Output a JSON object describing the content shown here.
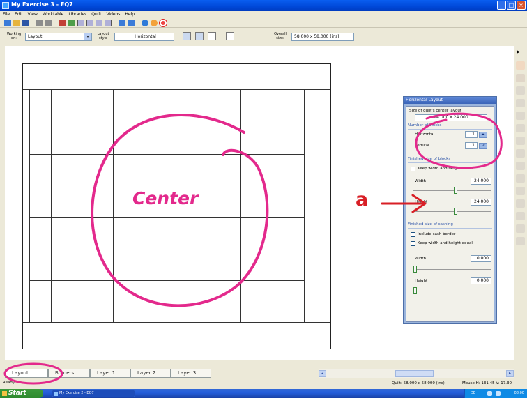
{
  "window": {
    "title": "My Exercise 3 - EQ7",
    "buttons": {
      "minimize": "_",
      "maximize": "□",
      "close": "×"
    }
  },
  "menu": [
    "File",
    "Edit",
    "View",
    "Worktable",
    "Libraries",
    "Quilt",
    "Videos",
    "Help"
  ],
  "options_bar": {
    "working_on_label": "Working on:",
    "working_on_value": "Layout",
    "layout_style_label": "Layout style",
    "layout_style_value": "Horizontal",
    "overall_size_label": "Overall size:",
    "overall_size_value": "58.000 x 58.000 (ins)"
  },
  "panel": {
    "title": "Horizontal Layout",
    "center_size_label": "Size of quilt's center layout",
    "center_size_value": "24.000 x 24.000",
    "number_of_blocks_label": "Number of blocks",
    "horizontal_label": "Horizontal",
    "horizontal_value": "1",
    "vertical_label": "Vertical",
    "vertical_value": "1",
    "finished_blocks_label": "Finished size of blocks",
    "keep_equal_label": "Keep width and height equal",
    "width_label": "Width",
    "width_value": "24.000",
    "height_label": "Height",
    "height_value": "24.000",
    "finished_sashing_label": "Finished size of sashing",
    "include_sash_border_label": "Include sash border",
    "keep_equal_label_2": "Keep width and height equal",
    "sash_width_label": "Width",
    "sash_width_value": "0.000",
    "sash_height_label": "Height",
    "sash_height_value": "0.000"
  },
  "tabs": [
    "Layout",
    "Borders",
    "Layer 1",
    "Layer 2",
    "Layer 3"
  ],
  "status": {
    "left": "Ready",
    "quilt_size": "Quilt: 58.000 x 58.000 (ins)",
    "mouse": "Mouse  H: 131.45  V: 17.30"
  },
  "taskbar": {
    "start": "Start",
    "item": "My Exercise 2 - EQ7",
    "lang": "DE",
    "clock": "08:00"
  },
  "annotations": {
    "center": "Center",
    "a": "a",
    "highlight_color": "#e3298c",
    "arrow_color": "#d81f26"
  }
}
